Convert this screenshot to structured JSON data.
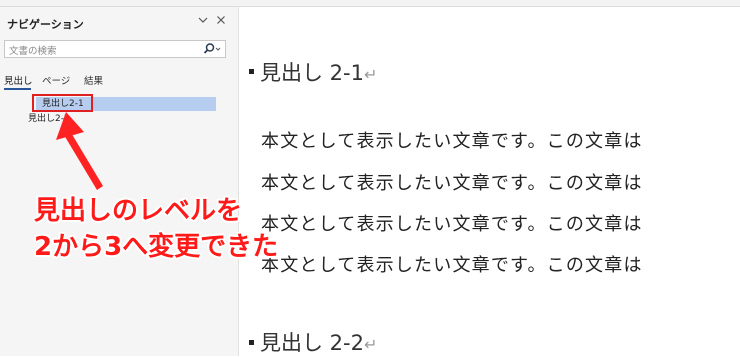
{
  "nav": {
    "title": "ナビゲーション",
    "search_placeholder": "文書の検索",
    "tabs": [
      {
        "label": "見出し",
        "active": true
      },
      {
        "label": "ページ",
        "active": false
      },
      {
        "label": "結果",
        "active": false
      }
    ],
    "headings": [
      {
        "label": "見出し2-1",
        "selected": true
      },
      {
        "label": "見出し2-2",
        "selected": false
      }
    ]
  },
  "annotation": {
    "line1": "見出しのレベルを",
    "line2": "2から3へ変更できた",
    "color": "#ff1a1a"
  },
  "document": {
    "heading1": "見出し 2-1",
    "heading2": "見出し 2-2",
    "paragraph_mark": "↵",
    "body_lines": [
      "本文として表示したい文章です。この文章は",
      "本文として表示したい文章です。この文章は",
      "本文として表示したい文章です。この文章は",
      "本文として表示したい文章です。この文章は"
    ]
  },
  "colors": {
    "selection": "#b6cdef",
    "tab_underline": "#2b579a",
    "highlight_border": "#e02020"
  }
}
